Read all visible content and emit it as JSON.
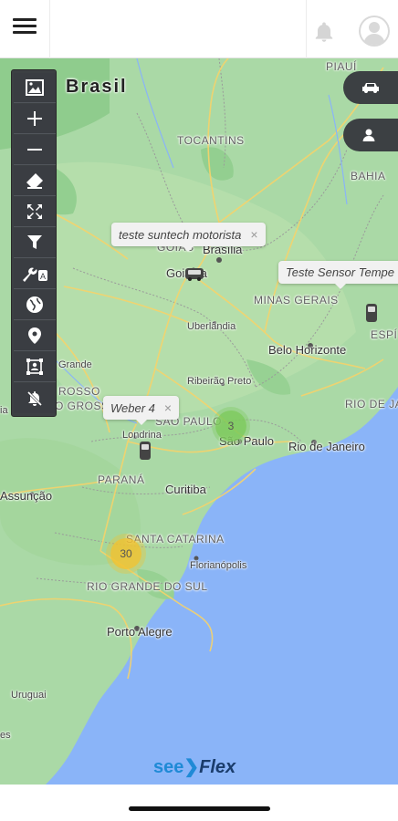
{
  "map": {
    "country_label": "Brasil",
    "state_labels": [
      "PIAUÍ",
      "TOCANTINS",
      "BAHIA",
      "GOIÁS",
      "MINAS GERAIS",
      "ESPÍ",
      "RIO DE JANEIRO",
      "SÃO PAULO",
      "PARANÁ",
      "SANTA CATARINA",
      "RIO GRANDE DO SUL",
      "ROSSO",
      "O GROSSO"
    ],
    "city_labels": [
      "Brasília",
      "Goiânia",
      "Uberlândia",
      "Belo Horizonte",
      "Ribeirão Preto",
      "São Paulo",
      "Rio de Janeiro",
      "Londrina",
      "Curitiba",
      "Florianópolis",
      "Porto Alegre",
      "Assunção",
      "Uruguai",
      "Grande",
      "es",
      "ia"
    ]
  },
  "popups": [
    {
      "text": "teste suntech motorista",
      "close": "×"
    },
    {
      "text": "Teste Sensor Tempe",
      "close": ""
    },
    {
      "text": "Weber 4",
      "close": "×"
    }
  ],
  "clusters": [
    {
      "count": "3",
      "color": "#7cc95a"
    },
    {
      "count": "30",
      "color": "#f2c230"
    }
  ],
  "toolbar": {
    "icons": [
      "image-layer-icon",
      "zoom-in-icon",
      "zoom-out-icon",
      "eraser-icon",
      "fullscreen-icon",
      "filter-icon",
      "tools-icon",
      "globe-icon",
      "location-pin-icon",
      "select-area-icon",
      "notifications-off-icon"
    ]
  },
  "branding": {
    "see": "see",
    "flex": "Flex",
    "see_color": "#1f8ad6",
    "flex_color": "#1a3c6b"
  }
}
